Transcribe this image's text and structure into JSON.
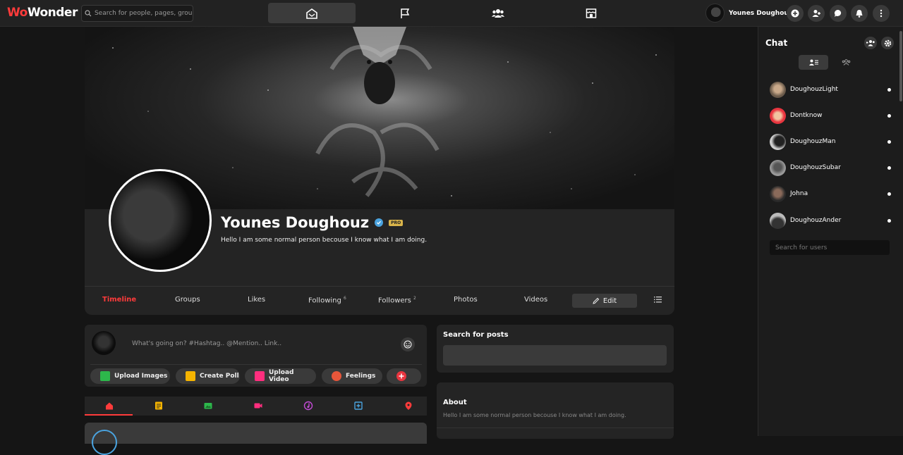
{
  "app": {
    "logo_prefix": "Wo",
    "logo_suffix": "Wonder",
    "accent": "#ff3b3b"
  },
  "topbar": {
    "search_placeholder": "Search for people, pages, groups and #hashtags",
    "nav": [
      "home-icon",
      "flag-icon",
      "groups-icon",
      "market-icon"
    ],
    "user_name": "Younes Doughouz",
    "actions": [
      "plus-icon",
      "add-user-icon",
      "chat-icon",
      "bell-icon",
      "more-icon"
    ]
  },
  "profile": {
    "name": "Younes Doughouz",
    "badge": "PRO",
    "bio": "Hello I am some normal person becouse I know what I am doing.",
    "tabs": [
      {
        "label": "Timeline",
        "count": ""
      },
      {
        "label": "Groups",
        "count": ""
      },
      {
        "label": "Likes",
        "count": ""
      },
      {
        "label": "Following",
        "count": "6"
      },
      {
        "label": "Followers",
        "count": "2"
      },
      {
        "label": "Photos",
        "count": ""
      },
      {
        "label": "Videos",
        "count": ""
      }
    ],
    "edit_label": "Edit"
  },
  "composer": {
    "placeholder": "What's going on? #Hashtag.. @Mention.. Link..",
    "actions": [
      {
        "label": "Upload Images",
        "color": "#2db84b"
      },
      {
        "label": "Create Poll",
        "color": "#f5b400"
      },
      {
        "label": "Upload Video",
        "color": "#ff2e7e"
      },
      {
        "label": "Feelings",
        "color": "#e8563a"
      }
    ]
  },
  "filters": [
    {
      "icon": "home-icon",
      "color": "#ff3b3b"
    },
    {
      "icon": "document-icon",
      "color": "#f5b400"
    },
    {
      "icon": "image-icon",
      "color": "#2db84b"
    },
    {
      "icon": "video-icon",
      "color": "#ff2e7e"
    },
    {
      "icon": "music-icon",
      "color": "#c34bd6"
    },
    {
      "icon": "file-icon",
      "color": "#4aa3df"
    },
    {
      "icon": "location-icon",
      "color": "#ff3b3b"
    }
  ],
  "sidebar_widgets": {
    "search_title": "Search for posts",
    "about_title": "About",
    "about_text": "Hello I am some normal person becouse I know what I am doing."
  },
  "chat": {
    "title": "Chat",
    "users": [
      {
        "name": "DoughouzLight"
      },
      {
        "name": "Dontknow"
      },
      {
        "name": "DoughouzMan"
      },
      {
        "name": "DoughouzSubar"
      },
      {
        "name": "Johna"
      },
      {
        "name": "DoughouzAnder"
      }
    ],
    "search_placeholder": "Search for users"
  }
}
